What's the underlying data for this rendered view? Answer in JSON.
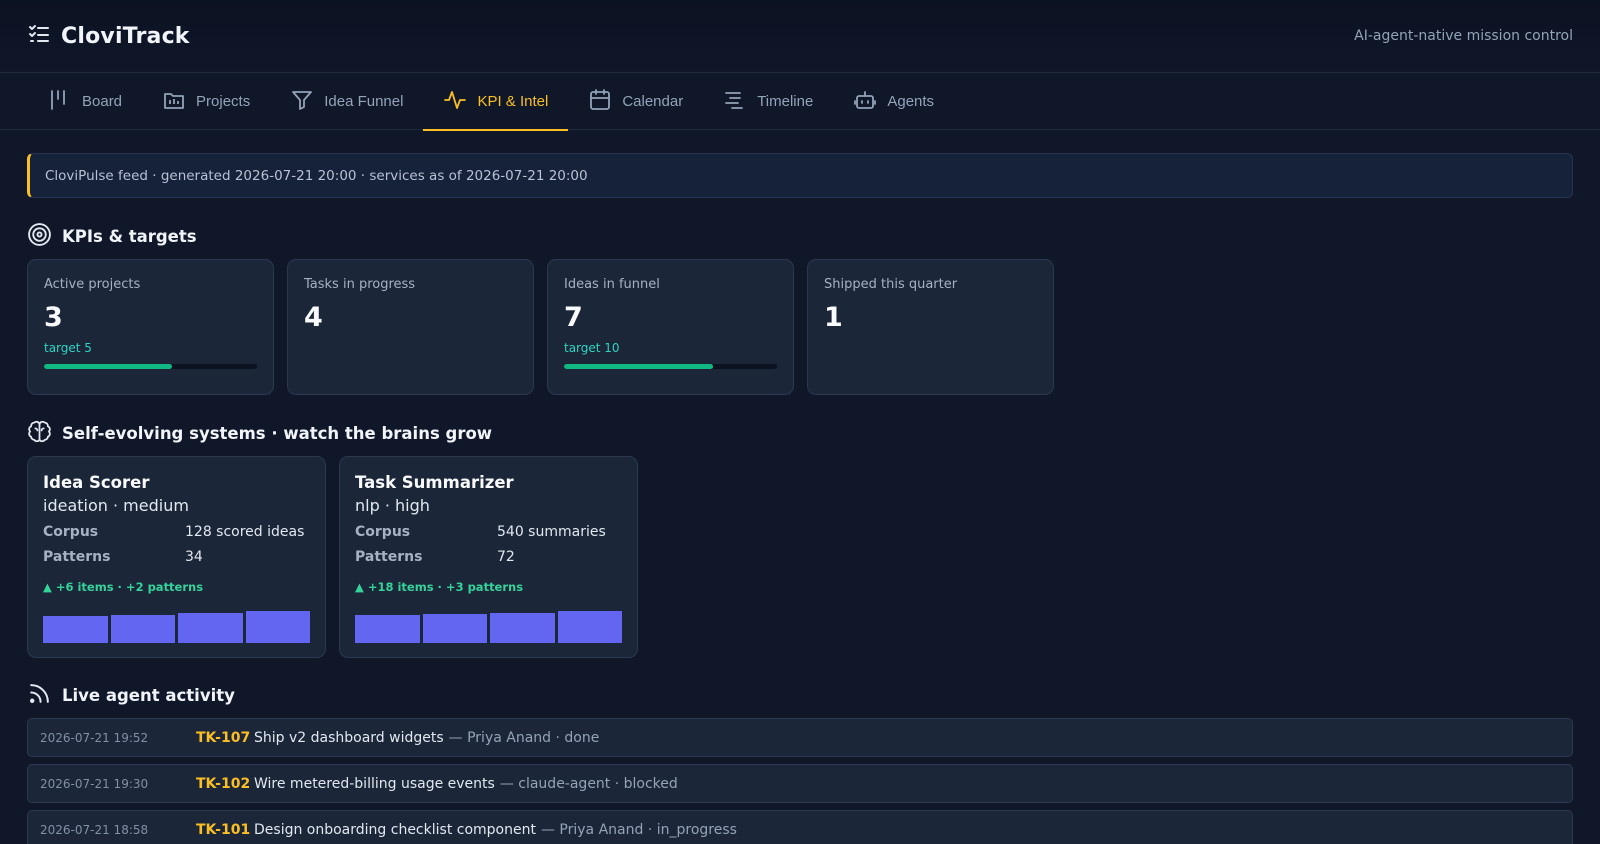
{
  "app": {
    "name": "CloviTrack",
    "tagline": "AI-agent-native mission control"
  },
  "nav": [
    {
      "label": "Board",
      "icon": "board-icon"
    },
    {
      "label": "Projects",
      "icon": "projects-icon"
    },
    {
      "label": "Idea Funnel",
      "icon": "funnel-icon"
    },
    {
      "label": "KPI & Intel",
      "icon": "pulse-icon",
      "active": true
    },
    {
      "label": "Calendar",
      "icon": "calendar-icon"
    },
    {
      "label": "Timeline",
      "icon": "timeline-icon"
    },
    {
      "label": "Agents",
      "icon": "robot-icon"
    }
  ],
  "feed_banner": "CloviPulse feed · generated 2026-07-21 20:00 · services as of 2026-07-21 20:00",
  "kpis": {
    "title": "KPIs & targets",
    "cards": [
      {
        "label": "Active projects",
        "value": "3",
        "target": "target 5",
        "progress": 0.6
      },
      {
        "label": "Tasks in progress",
        "value": "4"
      },
      {
        "label": "Ideas in funnel",
        "value": "7",
        "target": "target 10",
        "progress": 0.7
      },
      {
        "label": "Shipped this quarter",
        "value": "1"
      }
    ]
  },
  "systems": {
    "title": "Self-evolving systems · watch the brains grow",
    "cards": [
      {
        "name": "Idea Scorer",
        "subtitle": "ideation · medium",
        "corpus_label": "Corpus",
        "corpus": "128 scored ideas",
        "patterns_label": "Patterns",
        "patterns": "34",
        "delta": "▲ +6 items · +2 patterns",
        "growth": [
          0.84,
          0.88,
          0.94,
          1.0
        ]
      },
      {
        "name": "Task Summarizer",
        "subtitle": "nlp · high",
        "corpus_label": "Corpus",
        "corpus": "540 summaries",
        "patterns_label": "Patterns",
        "patterns": "72",
        "delta": "▲ +18 items · +3 patterns",
        "growth": [
          0.86,
          0.9,
          0.95,
          1.0
        ]
      }
    ]
  },
  "activity": {
    "title": "Live agent activity",
    "rows": [
      {
        "time": "2026-07-21 19:52",
        "id": "TK-107",
        "title": "Ship v2 dashboard widgets",
        "meta": "— Priya Anand · done"
      },
      {
        "time": "2026-07-21 19:30",
        "id": "TK-102",
        "title": "Wire metered-billing usage events",
        "meta": "— claude-agent · blocked"
      },
      {
        "time": "2026-07-21 18:58",
        "id": "TK-101",
        "title": "Design onboarding checklist component",
        "meta": "— Priya Anand · in_progress"
      }
    ]
  },
  "colors": {
    "accent": "#fbbf24",
    "progress": "#10b981",
    "target_text": "#2dd4bf",
    "growth_bar": "#6366f1",
    "delta": "#34d399"
  }
}
